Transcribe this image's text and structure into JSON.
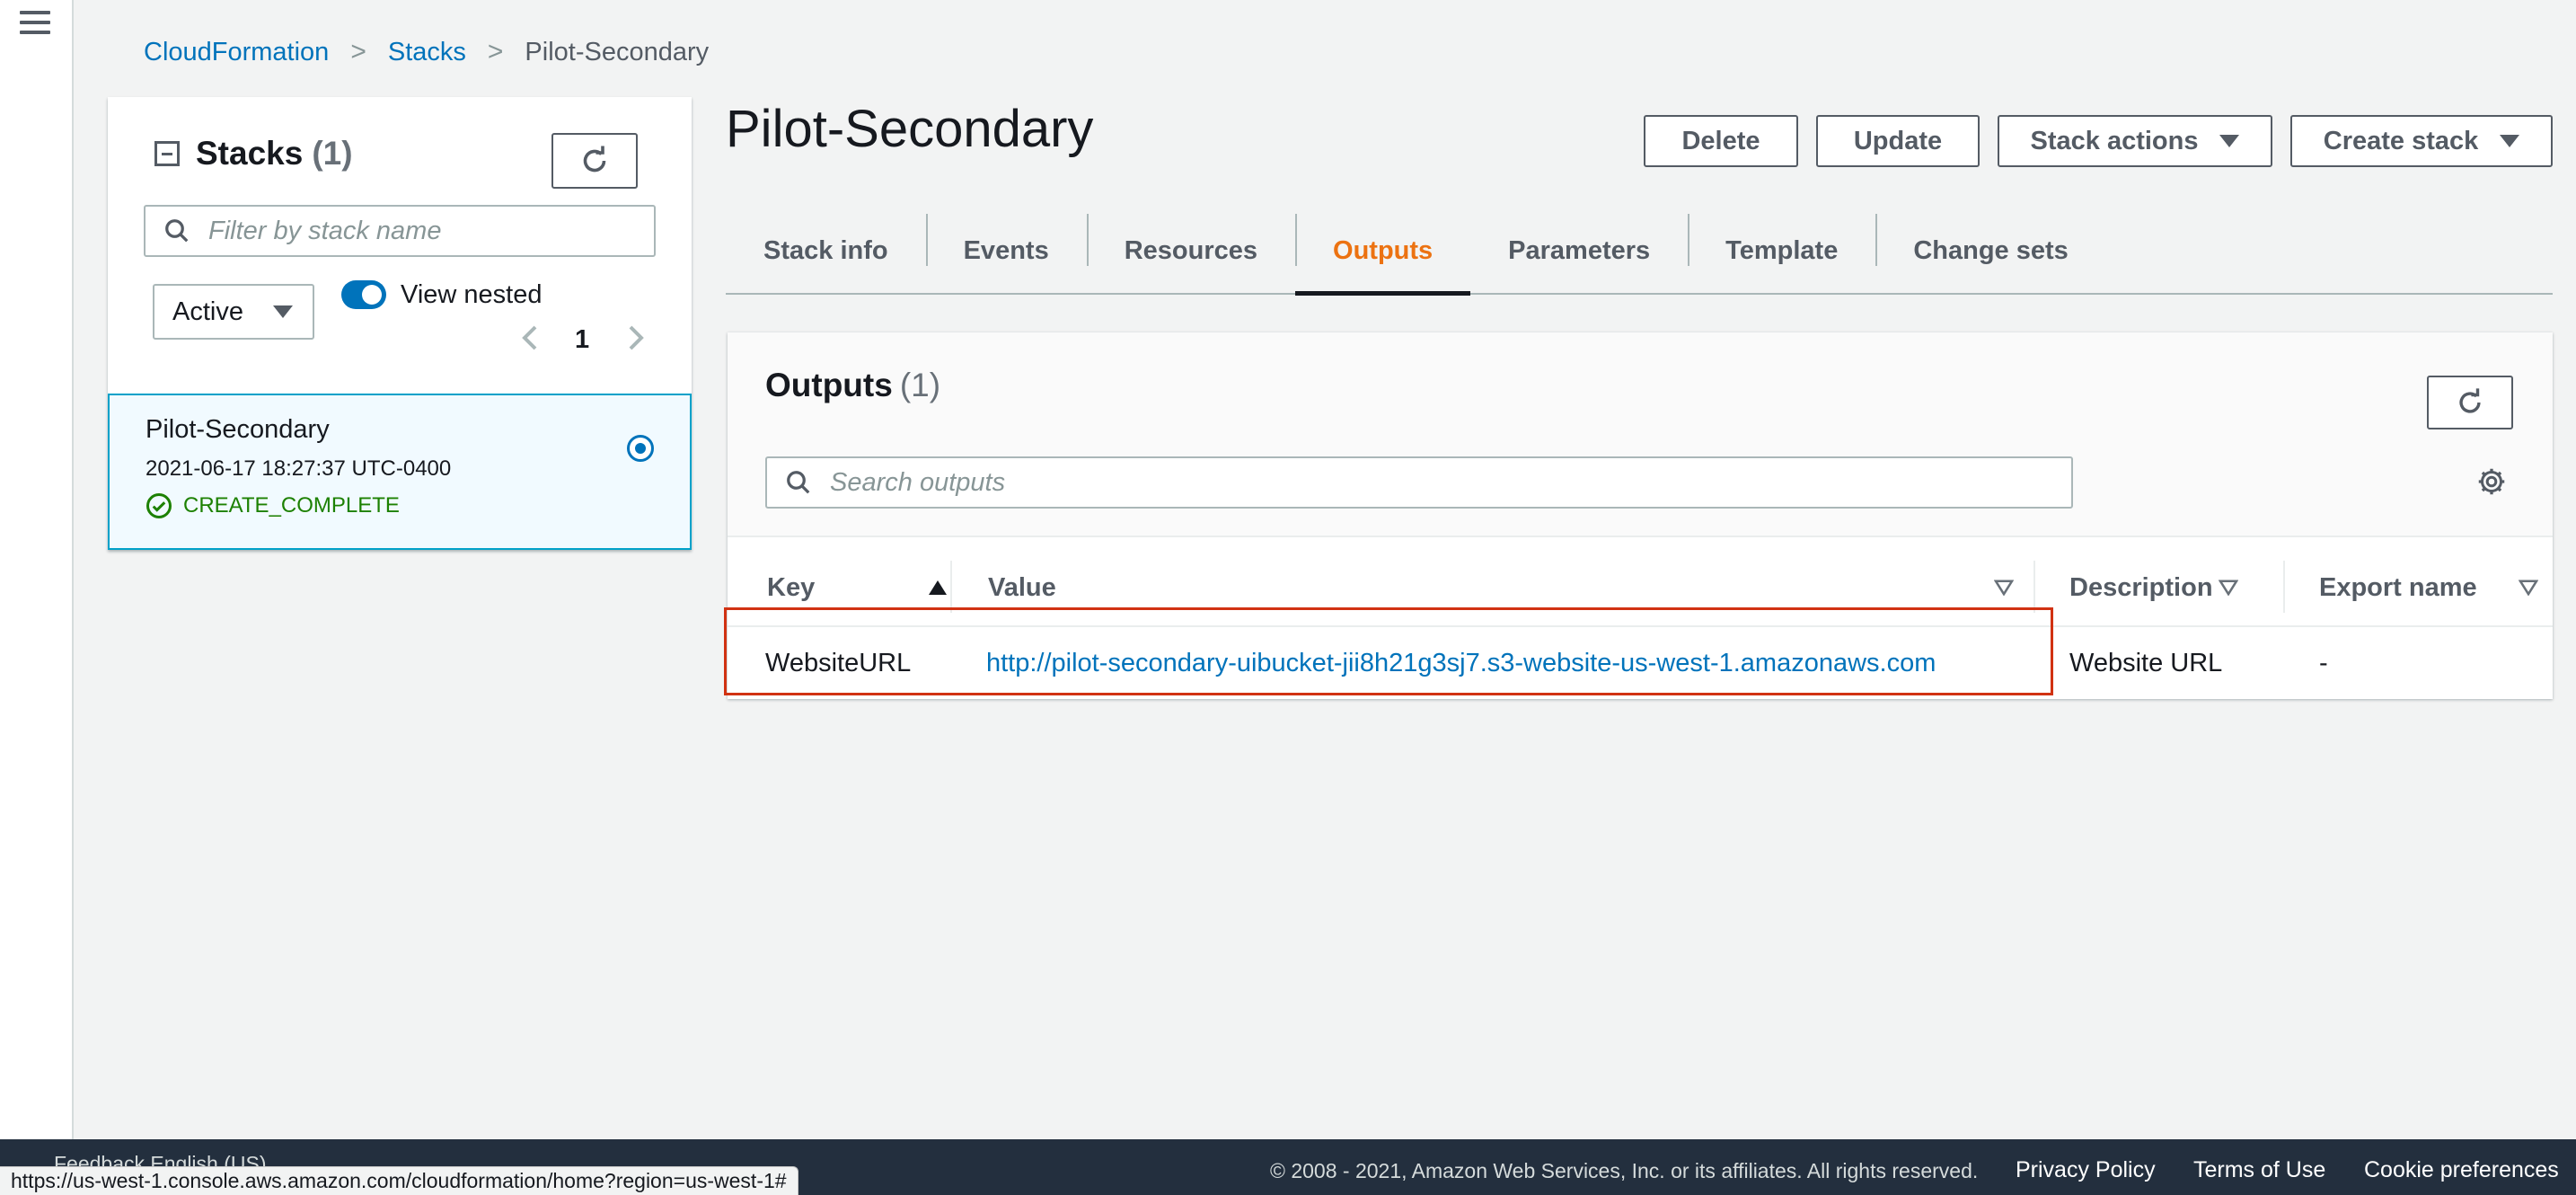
{
  "breadcrumb": {
    "items": [
      "CloudFormation",
      "Stacks"
    ],
    "current": "Pilot-Secondary"
  },
  "stacks_panel": {
    "title": "Stacks",
    "count": "(1)",
    "filter_placeholder": "Filter by stack name",
    "status_filter": "Active",
    "view_nested_label": "View nested",
    "view_nested_on": true,
    "page": "1",
    "stacks": [
      {
        "name": "Pilot-Secondary",
        "created": "2021-06-17 18:27:37 UTC-0400",
        "status": "CREATE_COMPLETE",
        "selected": true
      }
    ]
  },
  "header": {
    "title": "Pilot-Secondary",
    "buttons": {
      "delete": "Delete",
      "update": "Update",
      "stack_actions": "Stack actions",
      "create_stack": "Create stack"
    }
  },
  "tabs": [
    {
      "label": "Stack info"
    },
    {
      "label": "Events"
    },
    {
      "label": "Resources"
    },
    {
      "label": "Outputs",
      "active": true
    },
    {
      "label": "Parameters"
    },
    {
      "label": "Template"
    },
    {
      "label": "Change sets"
    }
  ],
  "outputs": {
    "title": "Outputs",
    "count": "(1)",
    "search_placeholder": "Search outputs",
    "columns": {
      "key": "Key",
      "value": "Value",
      "description": "Description",
      "export_name": "Export name"
    },
    "rows": [
      {
        "key": "WebsiteURL",
        "value": "http://pilot-secondary-uibucket-jii8h21g3sj7.s3-website-us-west-1.amazonaws.com",
        "description": "Website URL",
        "export_name": "-"
      }
    ]
  },
  "footer": {
    "feedback": "Feedback   English (US)",
    "copyright": "© 2008 - 2021, Amazon Web Services, Inc. or its affiliates. All rights reserved.",
    "links": [
      "Privacy Policy",
      "Terms of Use",
      "Cookie preferences"
    ]
  },
  "status_bar_url": "https://us-west-1.console.aws.amazon.com/cloudformation/home?region=us-west-1#",
  "colors": {
    "link": "#0073bb",
    "active_tab": "#ec7211",
    "success": "#1d8102",
    "highlight": "#d13212",
    "footer_bg": "#232f3e"
  }
}
